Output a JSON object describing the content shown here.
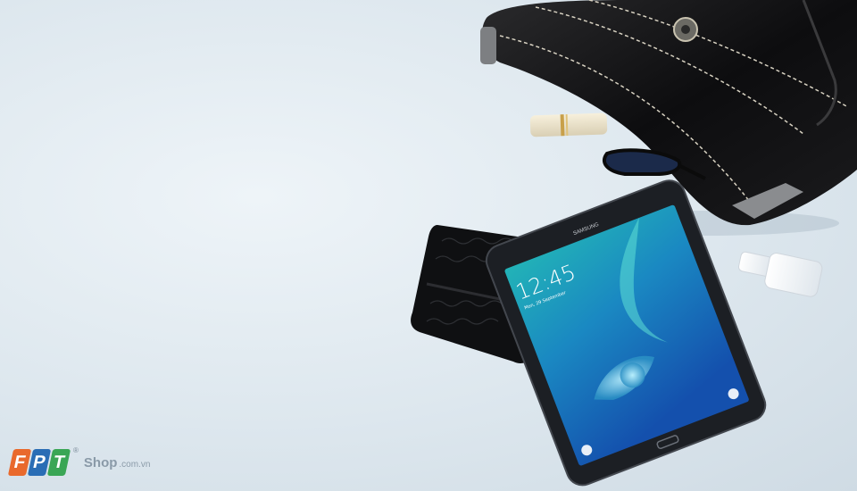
{
  "brand": {
    "letters": [
      "F",
      "P",
      "T"
    ],
    "registered": "®",
    "shop": "Shop",
    "domain": ".com.vn",
    "colors": [
      "#e9692c",
      "#2a6db5",
      "#3aa655"
    ]
  },
  "tablet": {
    "maker": "SAMSUNG",
    "lock_time": "12:45",
    "lock_date": "Mon, 29 September"
  },
  "colors": {
    "background": "#e3ebf1",
    "tablet_frame": "#1c1f24",
    "screen_top": "#1fa6b8",
    "screen_bottom": "#1557b0"
  }
}
